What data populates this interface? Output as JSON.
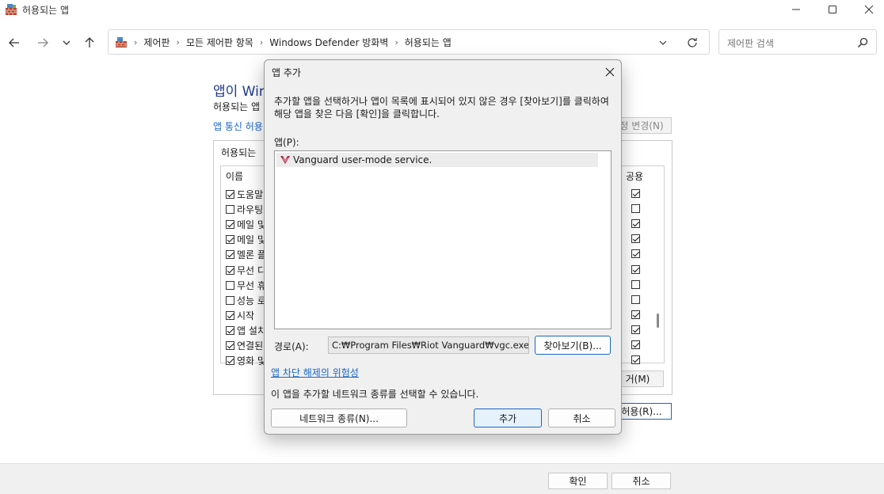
{
  "window": {
    "title": "허용되는 앱"
  },
  "address": {
    "crumbs": [
      "제어판",
      "모든 제어판 항목",
      "Windows Defender 방화벽",
      "허용되는 앱"
    ]
  },
  "search": {
    "placeholder": "제어판 검색"
  },
  "background": {
    "heading": "앱이 Win",
    "subtitle": "허용되는 앱",
    "link": "앱 통신 허용",
    "change_settings": "정 변경(N)",
    "group_label": "허용되는",
    "col_name": "이름",
    "col_public": "공용",
    "rows": [
      {
        "name": "도움말",
        "checked": true,
        "public": true
      },
      {
        "name": "라우팅",
        "checked": false,
        "public": false
      },
      {
        "name": "메일 및",
        "checked": true,
        "public": true
      },
      {
        "name": "메일 및",
        "checked": true,
        "public": true
      },
      {
        "name": "멜론 플",
        "checked": true,
        "public": true
      },
      {
        "name": "무선 디",
        "checked": true,
        "public": true
      },
      {
        "name": "무선 휴",
        "checked": false,
        "public": false
      },
      {
        "name": "성능 로",
        "checked": false,
        "public": false
      },
      {
        "name": "시작",
        "checked": true,
        "public": true
      },
      {
        "name": "앱 설치",
        "checked": true,
        "public": true
      },
      {
        "name": "연결된",
        "checked": true,
        "public": true
      },
      {
        "name": "영화 및",
        "checked": true,
        "public": true
      }
    ],
    "remove_button": "거(M)",
    "allow_button": "허용(R)..."
  },
  "footer": {
    "ok": "확인",
    "cancel": "취소"
  },
  "dialog": {
    "title": "앱 추가",
    "description": "추가할 앱을 선택하거나 앱이 목록에 표시되어 있지 않은 경우 [찾아보기]를 클릭하여 해당 앱을 찾은 다음 [확인]을 클릭합니다.",
    "apps_label": "앱(P):",
    "apps": [
      {
        "name": "Vanguard user-mode service.",
        "icon": "vanguard-icon",
        "selected": true
      }
    ],
    "path_label": "경로(A):",
    "path_value": "C:₩Program Files₩Riot Vanguard₩vgc.exe",
    "browse_button": "찾아보기(B)...",
    "risk_link": "앱 차단 해제의 위험성",
    "network_text": "이 앱을 추가할 네트워크 종류를 선택할 수 있습니다.",
    "network_button": "네트워크 종류(N)...",
    "add_button": "추가",
    "cancel_button": "취소"
  },
  "colors": {
    "accent": "#1a66c8",
    "vanguard": "#b0284a"
  }
}
